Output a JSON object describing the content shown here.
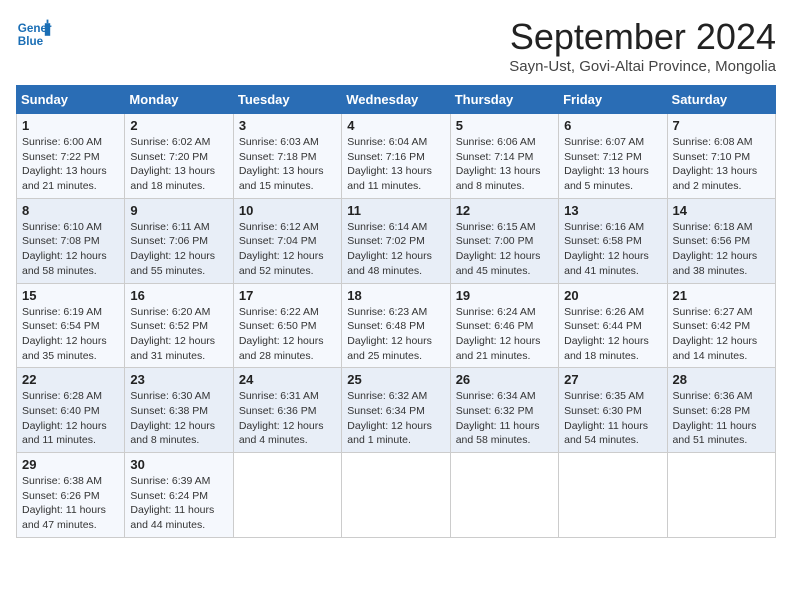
{
  "header": {
    "logo_line1": "General",
    "logo_line2": "Blue",
    "month_title": "September 2024",
    "subtitle": "Sayn-Ust, Govi-Altai Province, Mongolia"
  },
  "days_of_week": [
    "Sunday",
    "Monday",
    "Tuesday",
    "Wednesday",
    "Thursday",
    "Friday",
    "Saturday"
  ],
  "weeks": [
    [
      {
        "day": "1",
        "sunrise": "6:00 AM",
        "sunset": "7:22 PM",
        "daylight": "13 hours and 21 minutes."
      },
      {
        "day": "2",
        "sunrise": "6:02 AM",
        "sunset": "7:20 PM",
        "daylight": "13 hours and 18 minutes."
      },
      {
        "day": "3",
        "sunrise": "6:03 AM",
        "sunset": "7:18 PM",
        "daylight": "13 hours and 15 minutes."
      },
      {
        "day": "4",
        "sunrise": "6:04 AM",
        "sunset": "7:16 PM",
        "daylight": "13 hours and 11 minutes."
      },
      {
        "day": "5",
        "sunrise": "6:06 AM",
        "sunset": "7:14 PM",
        "daylight": "13 hours and 8 minutes."
      },
      {
        "day": "6",
        "sunrise": "6:07 AM",
        "sunset": "7:12 PM",
        "daylight": "13 hours and 5 minutes."
      },
      {
        "day": "7",
        "sunrise": "6:08 AM",
        "sunset": "7:10 PM",
        "daylight": "13 hours and 2 minutes."
      }
    ],
    [
      {
        "day": "8",
        "sunrise": "6:10 AM",
        "sunset": "7:08 PM",
        "daylight": "12 hours and 58 minutes."
      },
      {
        "day": "9",
        "sunrise": "6:11 AM",
        "sunset": "7:06 PM",
        "daylight": "12 hours and 55 minutes."
      },
      {
        "day": "10",
        "sunrise": "6:12 AM",
        "sunset": "7:04 PM",
        "daylight": "12 hours and 52 minutes."
      },
      {
        "day": "11",
        "sunrise": "6:14 AM",
        "sunset": "7:02 PM",
        "daylight": "12 hours and 48 minutes."
      },
      {
        "day": "12",
        "sunrise": "6:15 AM",
        "sunset": "7:00 PM",
        "daylight": "12 hours and 45 minutes."
      },
      {
        "day": "13",
        "sunrise": "6:16 AM",
        "sunset": "6:58 PM",
        "daylight": "12 hours and 41 minutes."
      },
      {
        "day": "14",
        "sunrise": "6:18 AM",
        "sunset": "6:56 PM",
        "daylight": "12 hours and 38 minutes."
      }
    ],
    [
      {
        "day": "15",
        "sunrise": "6:19 AM",
        "sunset": "6:54 PM",
        "daylight": "12 hours and 35 minutes."
      },
      {
        "day": "16",
        "sunrise": "6:20 AM",
        "sunset": "6:52 PM",
        "daylight": "12 hours and 31 minutes."
      },
      {
        "day": "17",
        "sunrise": "6:22 AM",
        "sunset": "6:50 PM",
        "daylight": "12 hours and 28 minutes."
      },
      {
        "day": "18",
        "sunrise": "6:23 AM",
        "sunset": "6:48 PM",
        "daylight": "12 hours and 25 minutes."
      },
      {
        "day": "19",
        "sunrise": "6:24 AM",
        "sunset": "6:46 PM",
        "daylight": "12 hours and 21 minutes."
      },
      {
        "day": "20",
        "sunrise": "6:26 AM",
        "sunset": "6:44 PM",
        "daylight": "12 hours and 18 minutes."
      },
      {
        "day": "21",
        "sunrise": "6:27 AM",
        "sunset": "6:42 PM",
        "daylight": "12 hours and 14 minutes."
      }
    ],
    [
      {
        "day": "22",
        "sunrise": "6:28 AM",
        "sunset": "6:40 PM",
        "daylight": "12 hours and 11 minutes."
      },
      {
        "day": "23",
        "sunrise": "6:30 AM",
        "sunset": "6:38 PM",
        "daylight": "12 hours and 8 minutes."
      },
      {
        "day": "24",
        "sunrise": "6:31 AM",
        "sunset": "6:36 PM",
        "daylight": "12 hours and 4 minutes."
      },
      {
        "day": "25",
        "sunrise": "6:32 AM",
        "sunset": "6:34 PM",
        "daylight": "12 hours and 1 minute."
      },
      {
        "day": "26",
        "sunrise": "6:34 AM",
        "sunset": "6:32 PM",
        "daylight": "11 hours and 58 minutes."
      },
      {
        "day": "27",
        "sunrise": "6:35 AM",
        "sunset": "6:30 PM",
        "daylight": "11 hours and 54 minutes."
      },
      {
        "day": "28",
        "sunrise": "6:36 AM",
        "sunset": "6:28 PM",
        "daylight": "11 hours and 51 minutes."
      }
    ],
    [
      {
        "day": "29",
        "sunrise": "6:38 AM",
        "sunset": "6:26 PM",
        "daylight": "11 hours and 47 minutes."
      },
      {
        "day": "30",
        "sunrise": "6:39 AM",
        "sunset": "6:24 PM",
        "daylight": "11 hours and 44 minutes."
      },
      null,
      null,
      null,
      null,
      null
    ]
  ]
}
